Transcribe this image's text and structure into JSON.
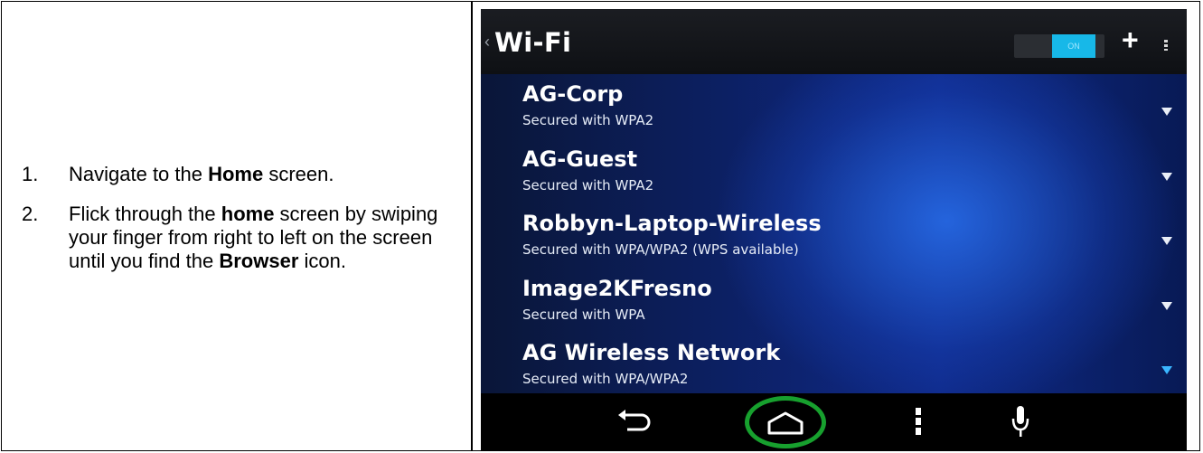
{
  "instructions": [
    {
      "num": "1.",
      "before": "Navigate to the ",
      "bold": "Home",
      "after": " screen."
    },
    {
      "num": "2.",
      "before": "Flick through the ",
      "bold": "home",
      "after": " screen by swiping your finger from right to left on the screen until you find the ",
      "bold2": "Browser",
      "after2": " icon."
    }
  ],
  "screen": {
    "title": "Wi-Fi",
    "toggle_label": "ON",
    "add_symbol": "+",
    "networks": [
      {
        "name": "AG-Corp",
        "security": "Secured with WPA2"
      },
      {
        "name": "AG-Guest",
        "security": "Secured with WPA2"
      },
      {
        "name": "Robbyn-Laptop-Wireless",
        "security": "Secured with WPA/WPA2 (WPS available)"
      },
      {
        "name": "Image2KFresno",
        "security": "Secured with WPA"
      },
      {
        "name": "AG Wireless Network",
        "security": "Secured with WPA/WPA2"
      }
    ],
    "icons": {
      "wifi": "wifi-signal-icon",
      "back": "back-arrow-icon",
      "home": "home-icon",
      "menu": "menu-icon",
      "mic": "microphone-icon"
    },
    "colors": {
      "accent": "#17b8e8",
      "highlight_ring": "#17a02e"
    }
  }
}
